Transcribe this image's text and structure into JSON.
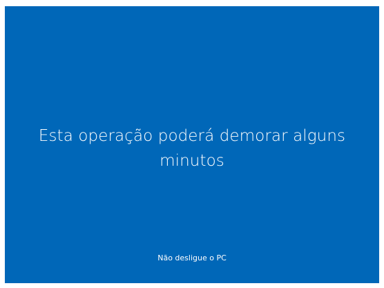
{
  "screen": {
    "background_color": "#0067b8",
    "text_color": "#ffffff",
    "message_line1": "Esta operação poderá demorar alguns",
    "message_line2": "minutos",
    "hint": "Não desligue o PC"
  }
}
